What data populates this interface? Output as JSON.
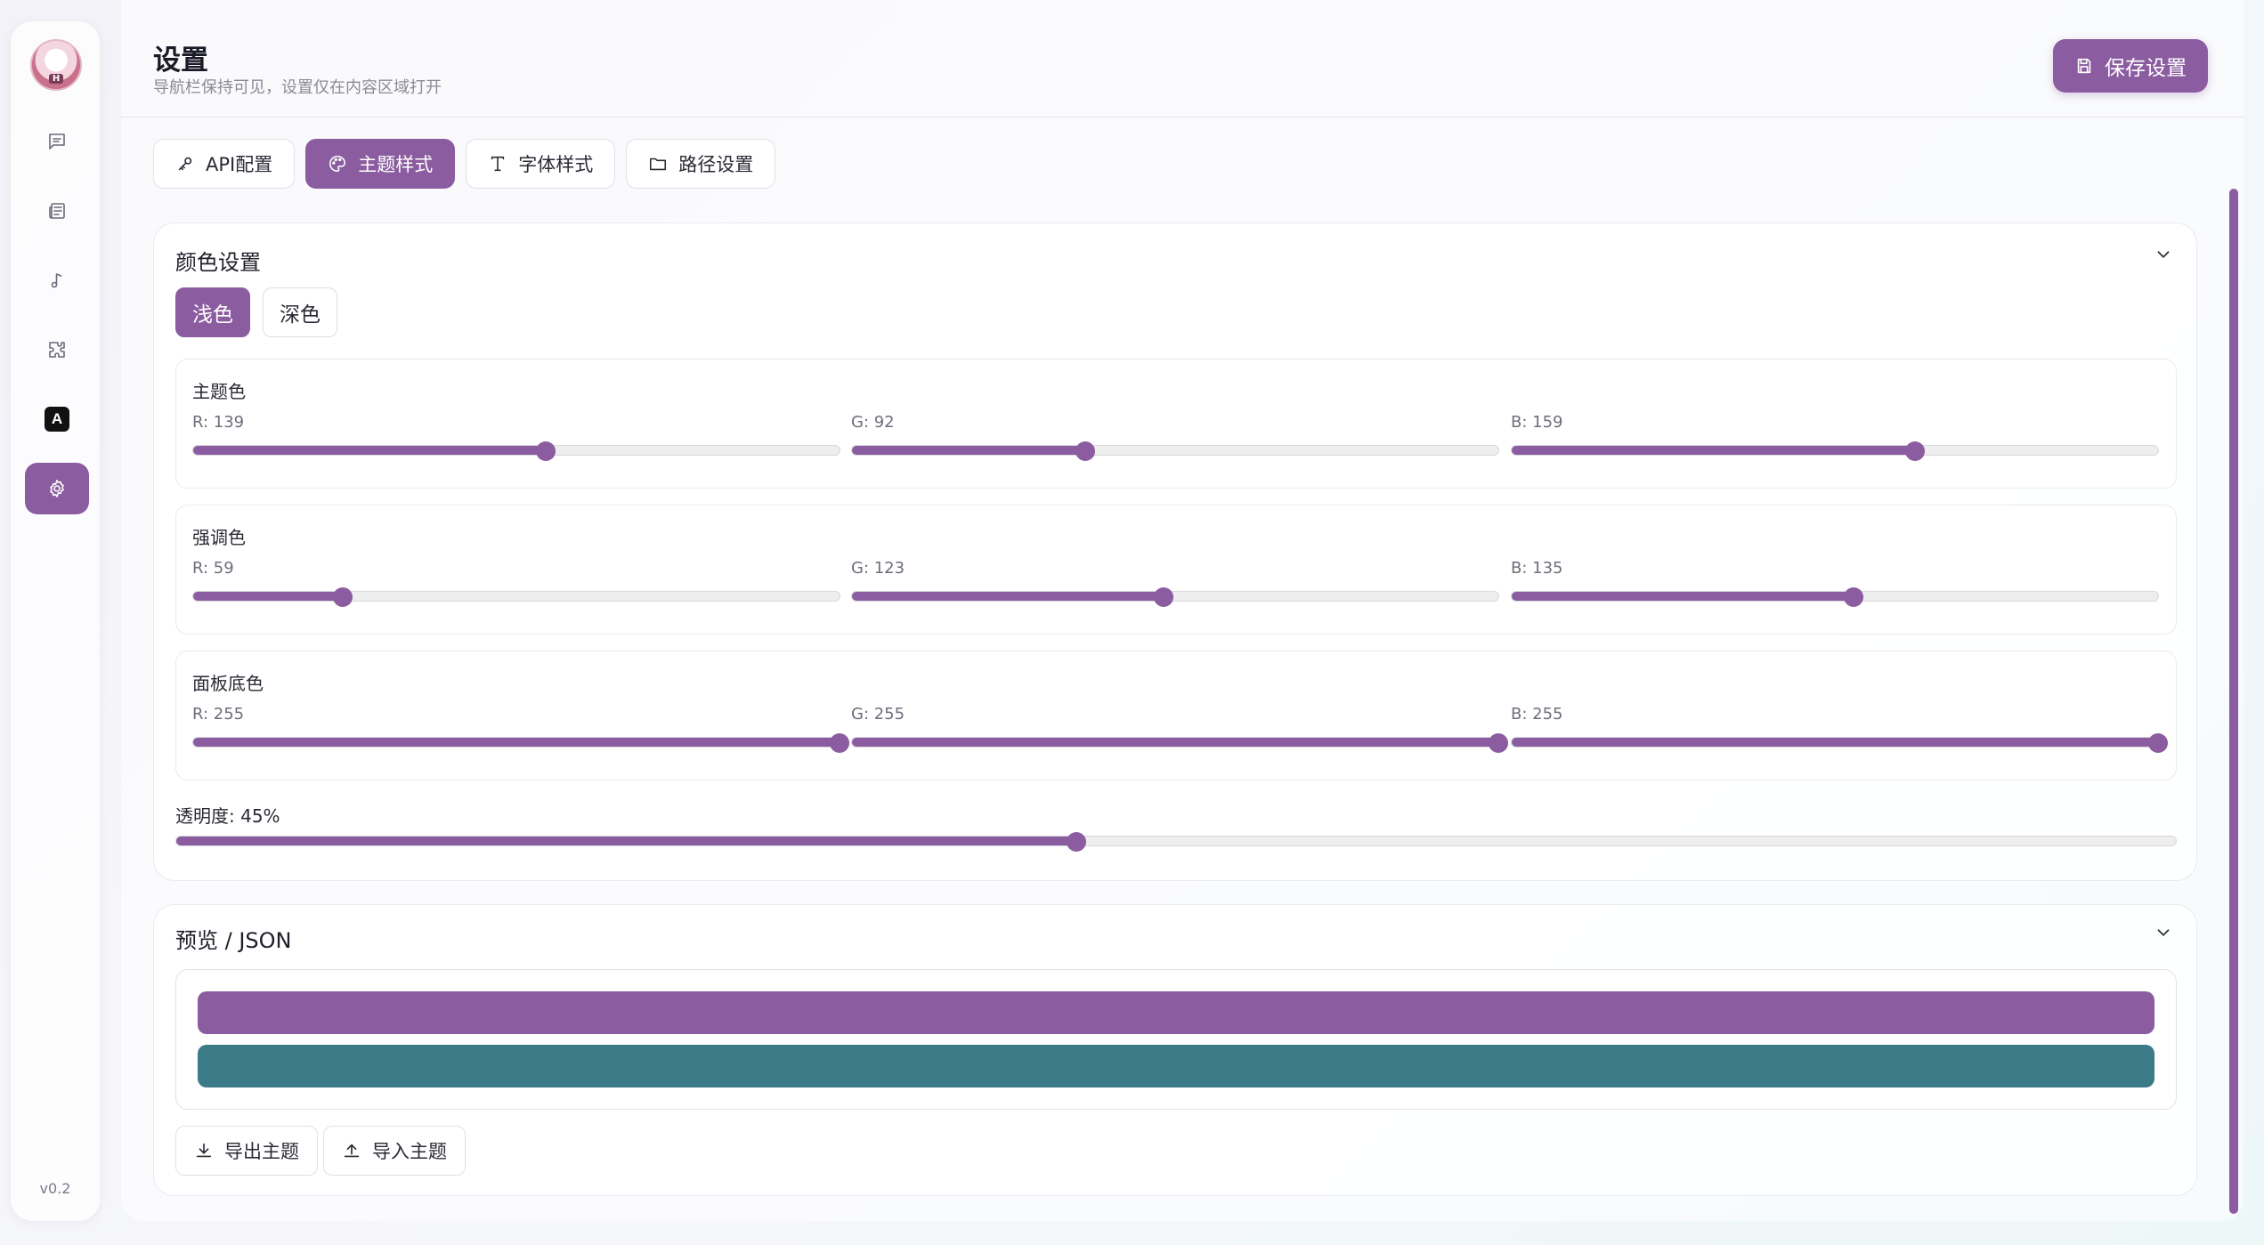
{
  "sidebar": {
    "avatar_tag": "H",
    "items": [
      {
        "name": "chat",
        "icon": "message-square-icon"
      },
      {
        "name": "notes",
        "icon": "newspaper-icon"
      },
      {
        "name": "music",
        "icon": "music-note-icon"
      },
      {
        "name": "plugins",
        "icon": "puzzle-icon"
      },
      {
        "name": "font",
        "icon": "a-badge-icon",
        "label": "A"
      },
      {
        "name": "settings",
        "icon": "gear-icon",
        "active": true
      }
    ],
    "version": "v0.2"
  },
  "header": {
    "title": "设置",
    "subtitle": "导航栏保持可见，设置仅在内容区域打开",
    "save_label": "保存设置"
  },
  "tabs": [
    {
      "label": "API配置",
      "icon": "key-icon",
      "active": false
    },
    {
      "label": "主题样式",
      "icon": "palette-icon",
      "active": true
    },
    {
      "label": "字体样式",
      "icon": "type-icon",
      "active": false
    },
    {
      "label": "路径设置",
      "icon": "folder-icon",
      "active": false
    }
  ],
  "colors_section": {
    "title": "颜色设置",
    "modes": [
      {
        "label": "浅色",
        "active": true
      },
      {
        "label": "深色",
        "active": false
      }
    ],
    "groups": [
      {
        "label": "主题色",
        "r": 139,
        "g": 92,
        "b": 159,
        "r_label": "R: 139",
        "g_label": "G: 92",
        "b_label": "B: 159"
      },
      {
        "label": "强调色",
        "r": 59,
        "g": 123,
        "b": 135,
        "r_label": "R: 59",
        "g_label": "G: 123",
        "b_label": "B: 135"
      },
      {
        "label": "面板底色",
        "r": 255,
        "g": 255,
        "b": 255,
        "r_label": "R: 255",
        "g_label": "G: 255",
        "b_label": "B: 255"
      }
    ],
    "opacity_label": "透明度: 45%",
    "opacity": 45
  },
  "preview_section": {
    "title": "预览 / JSON",
    "primary_color": "#8b5c9f",
    "accent_color": "#3b7b87",
    "export_label": "导出主题",
    "import_label": "导入主题"
  }
}
